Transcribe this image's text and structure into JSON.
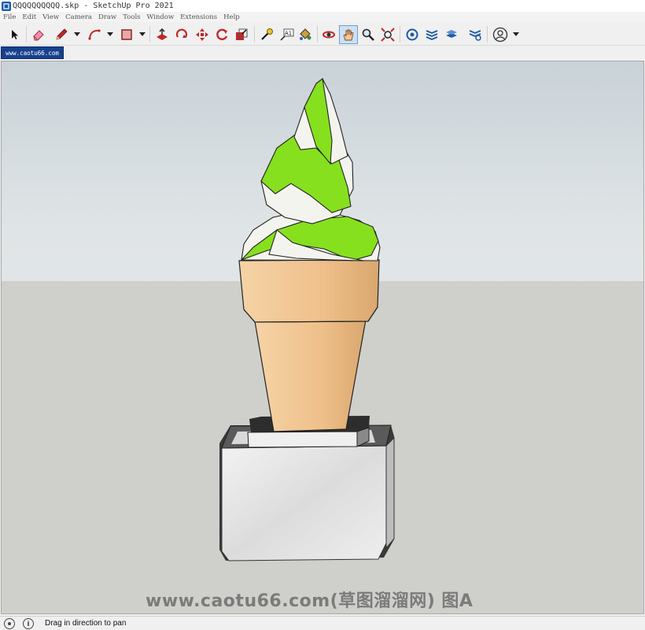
{
  "window": {
    "title": "QQQQQQQQQQ.skp - SketchUp Pro 2021"
  },
  "menu": [
    "File",
    "Edit",
    "View",
    "Camera",
    "Draw",
    "Tools",
    "Window",
    "Extensions",
    "Help"
  ],
  "toolbar": {
    "tools": [
      {
        "name": "select-tool",
        "icon": "arrow-cursor-icon"
      },
      {
        "name": "eraser-tool",
        "icon": "eraser-icon"
      },
      {
        "name": "line-tool",
        "icon": "pencil-icon"
      },
      {
        "name": "arc-tool",
        "icon": "arc-icon"
      },
      {
        "name": "rectangle-tool",
        "icon": "rectangle-icon"
      },
      {
        "name": "push-pull-tool",
        "icon": "push-pull-icon"
      },
      {
        "name": "rotate-tool",
        "icon": "rotate-icon"
      },
      {
        "name": "move-tool",
        "icon": "move-arrows-icon"
      },
      {
        "name": "follow-me-tool",
        "icon": "follow-me-icon"
      },
      {
        "name": "scale-tool",
        "icon": "scale-icon"
      },
      {
        "name": "tape-measure-tool",
        "icon": "tape-measure-icon"
      },
      {
        "name": "text-tool",
        "icon": "text-label-icon"
      },
      {
        "name": "paint-bucket-tool",
        "icon": "paint-bucket-icon"
      },
      {
        "name": "orbit-tool",
        "icon": "orbit-icon"
      },
      {
        "name": "pan-tool",
        "icon": "hand-icon",
        "active": true
      },
      {
        "name": "zoom-tool",
        "icon": "magnifier-icon"
      },
      {
        "name": "zoom-extents-tool",
        "icon": "zoom-extents-icon"
      },
      {
        "name": "3d-warehouse",
        "icon": "warehouse-icon"
      },
      {
        "name": "extension-warehouse",
        "icon": "extension-warehouse-icon"
      },
      {
        "name": "layout-send",
        "icon": "layout-icon"
      },
      {
        "name": "extension-manager",
        "icon": "extension-manager-icon"
      },
      {
        "name": "account",
        "icon": "user-circle-icon"
      }
    ],
    "text_tool_glyph": "A1"
  },
  "scene_tab": {
    "label": "www.caotu66.com"
  },
  "watermark": {
    "text": "www.caotu66.com(草图溜溜网) 图A"
  },
  "status": {
    "text": "Drag in direction to pan",
    "icons": [
      "geo-location-icon",
      "info-icon"
    ],
    "info_glyph": "i"
  },
  "colors": {
    "title_tab": "#18418d",
    "swirl_green": "#86e01e",
    "swirl_white": "#f4f4ef",
    "cone": "#f0c590",
    "base": "#e2e2e2",
    "active_tool": "#cde0f3"
  }
}
